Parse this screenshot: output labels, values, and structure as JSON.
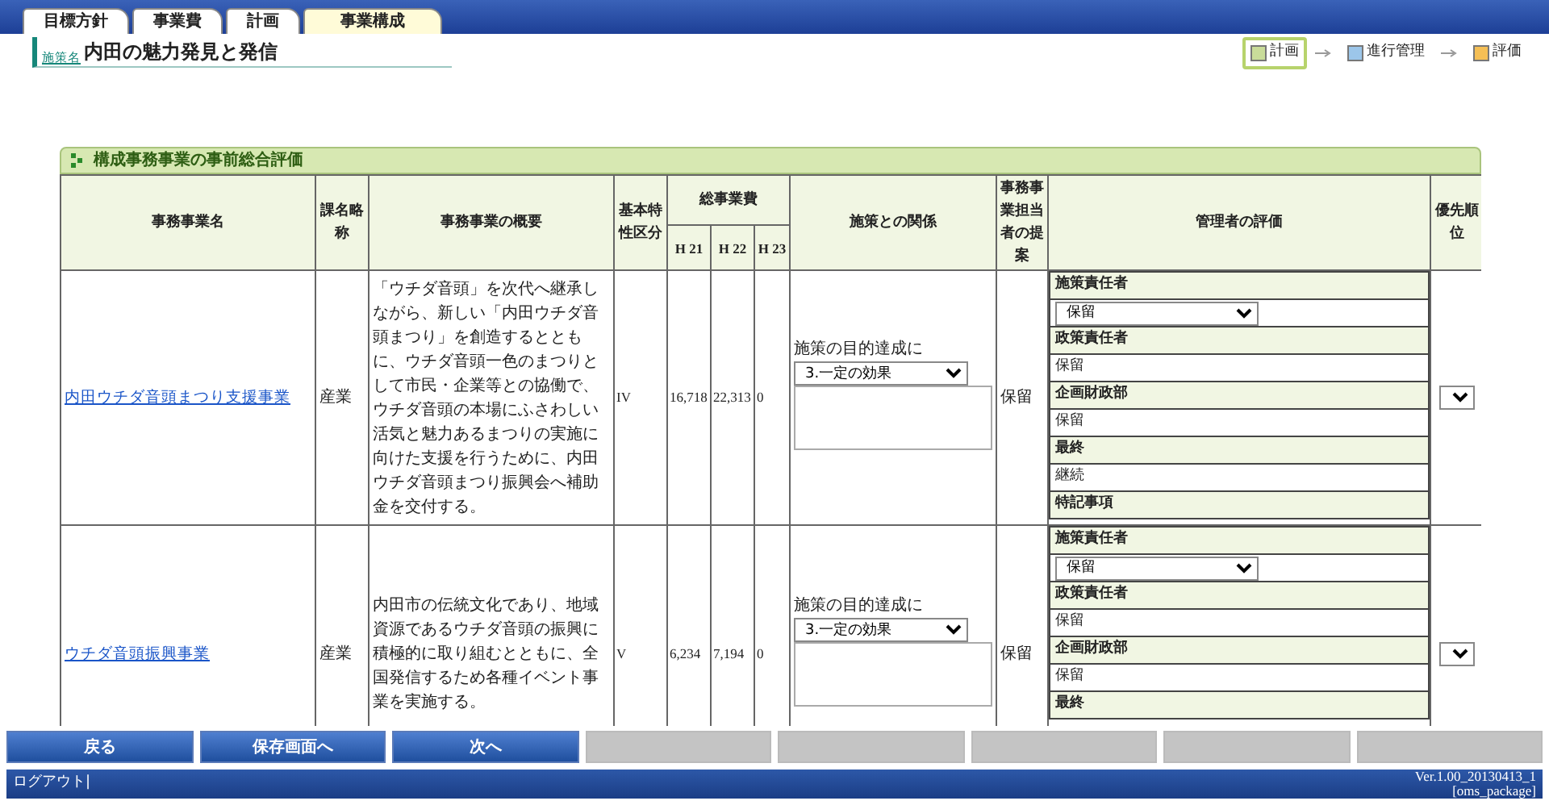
{
  "tabs": [
    {
      "label": "目標方針",
      "selected": false
    },
    {
      "label": "事業費",
      "selected": false
    },
    {
      "label": "計画",
      "selected": false
    },
    {
      "label": "事業構成",
      "selected": true
    }
  ],
  "policy": {
    "label": "施策名",
    "title": "内田の魅力発見と発信"
  },
  "workflow": [
    {
      "label": "計画",
      "color": "#c9dc9a",
      "selected": true
    },
    {
      "label": "進行管理",
      "color": "#9cc6ea",
      "selected": false
    },
    {
      "label": "評価",
      "color": "#f5bf55",
      "selected": false
    }
  ],
  "section": {
    "title": "構成事務事業の事前総合評価",
    "columns": [
      {
        "label": "事務事業名"
      },
      {
        "label": "課名略称"
      },
      {
        "label": "事務事業の概要"
      },
      {
        "label": "基本特性区分"
      },
      {
        "label": "総事業費",
        "children": [
          "H 21",
          "H 22",
          "H 23"
        ]
      },
      {
        "label": "施策との関係"
      },
      {
        "label": "事務事業担当者の提案"
      },
      {
        "label": "管理者の評価"
      },
      {
        "label": "優先順位"
      }
    ],
    "rows": [
      {
        "name": "内田ウチダ音頭まつり支援事業",
        "dept": "産業",
        "summary": "「ウチダ音頭」を次代へ継承しながら、新しい「内田ウチダ音頭まつり」を創造するとともに、ウチダ音頭一色のまつりとして市民・企業等との協働で、ウチダ音頭の本場にふさわしい活気と魅力あるまつりの実施に向けた支援を行うために、内田ウチダ音頭まつり振興会へ補助金を交付する。",
        "category": "IV",
        "costs": [
          "16,718",
          "22,313",
          "0"
        ],
        "relation": {
          "label": "施策の目的達成に",
          "value": "3.一定の効果"
        },
        "proposal": "保留",
        "evaluation": [
          {
            "kind": "label",
            "text": "施策責任者"
          },
          {
            "kind": "select",
            "text": "保留"
          },
          {
            "kind": "label",
            "text": "政策責任者"
          },
          {
            "kind": "value",
            "text": "保留"
          },
          {
            "kind": "label",
            "text": "企画財政部"
          },
          {
            "kind": "value",
            "text": "保留"
          },
          {
            "kind": "label",
            "text": "最終"
          },
          {
            "kind": "value",
            "text": "継続"
          },
          {
            "kind": "label",
            "text": "特記事項"
          }
        ]
      },
      {
        "name": "ウチダ音頭振興事業",
        "dept": "産業",
        "summary": "内田市の伝統文化であり、地域資源であるウチダ音頭の振興に積極的に取り組むとともに、全国発信するため各種イベント事業を実施する。",
        "category": "V",
        "costs": [
          "6,234",
          "7,194",
          "0"
        ],
        "relation": {
          "label": "施策の目的達成に",
          "value": "3.一定の効果"
        },
        "proposal": "保留",
        "evaluation": [
          {
            "kind": "label",
            "text": "施策責任者"
          },
          {
            "kind": "select",
            "text": "保留"
          },
          {
            "kind": "label",
            "text": "政策責任者"
          },
          {
            "kind": "value",
            "text": "保留"
          },
          {
            "kind": "label",
            "text": "企画財政部"
          },
          {
            "kind": "value",
            "text": "保留"
          },
          {
            "kind": "label",
            "text": "最終"
          }
        ]
      }
    ]
  },
  "buttons": [
    {
      "label": "戻る",
      "disabled": false
    },
    {
      "label": "保存画面へ",
      "disabled": false
    },
    {
      "label": "次へ",
      "disabled": false
    },
    {
      "disabled": true
    },
    {
      "disabled": true
    },
    {
      "disabled": true
    },
    {
      "disabled": true
    },
    {
      "disabled": true
    }
  ],
  "footer": {
    "logout": "ログアウト|",
    "version": "Ver.1.00_20130413_1",
    "package": "[oms_package]"
  }
}
